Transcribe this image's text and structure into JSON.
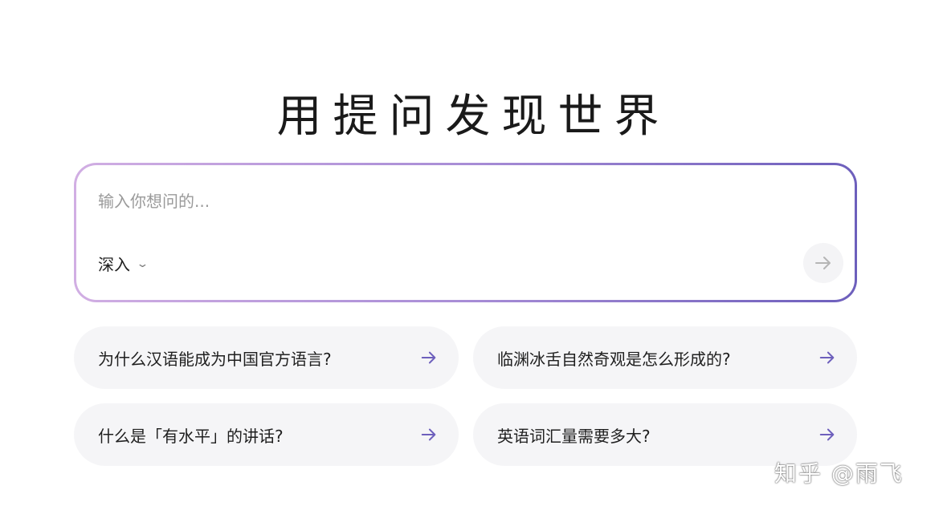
{
  "headline": "用提问发现世界",
  "search": {
    "placeholder": "输入你想问的...",
    "mode": "深入"
  },
  "icons": {
    "send": "arrow-right-icon",
    "mode_dropdown": "chevron-down-icon",
    "suggestion_arrow": "arrow-right-icon"
  },
  "colors": {
    "border_gradient_start": "#d1aee3",
    "border_gradient_end": "#6d5fbc",
    "suggestion_arrow": "#6d5fbc",
    "suggestion_bg": "#f5f5f7"
  },
  "suggestions": [
    {
      "text": "为什么汉语能成为中国官方语言?"
    },
    {
      "text": "临渊冰舌自然奇观是怎么形成的?"
    },
    {
      "text": "什么是「有水平」的讲话?"
    },
    {
      "text": "英语词汇量需要多大?"
    }
  ],
  "watermark": "知乎 @雨飞"
}
